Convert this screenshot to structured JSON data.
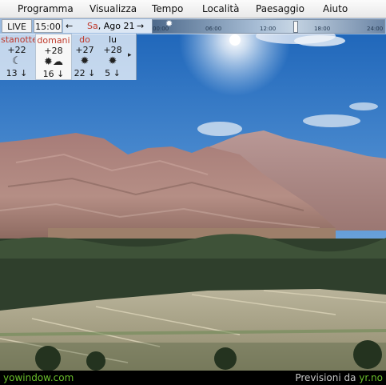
{
  "menu": [
    "Programma",
    "Visualizza",
    "Tempo",
    "Località",
    "Paesaggio",
    "Aiuto"
  ],
  "toolbar": {
    "live_label": "LIVE",
    "time": "15:00",
    "date_day": "Sa",
    "date_rest": ", Ago 21",
    "prev_arrow": "←",
    "next_arrow": "→",
    "timeline_ticks": [
      "00:00",
      "06:00",
      "12:00",
      "18:00",
      "24:00"
    ],
    "sun_icon": "sun-icon"
  },
  "forecast": {
    "days": [
      {
        "name": "stanotte",
        "temp": "+22",
        "icon": "moon-icon",
        "wind": "13",
        "name_color": "#c0392b",
        "selected": false
      },
      {
        "name": "domani",
        "temp": "+28",
        "icon": "partly-cloudy-icon",
        "wind": "16",
        "name_color": "#c0392b",
        "selected": true
      },
      {
        "name": "do",
        "temp": "+27",
        "icon": "sun-icon",
        "wind": "22",
        "name_color": "#c0392b",
        "selected": false
      },
      {
        "name": "lu",
        "temp": "+28",
        "icon": "sun-icon",
        "wind": "5",
        "name_color": "#111111",
        "selected": false
      }
    ],
    "more_arrow": "▸"
  },
  "status": {
    "site": "yowindow.com",
    "credit_prefix": "Previsioni da ",
    "credit_link": "yr.no"
  },
  "colors": {
    "link_green": "#6abf2b",
    "sky_top": "#1a5fb4",
    "sky_bottom": "#b9d3ec"
  }
}
